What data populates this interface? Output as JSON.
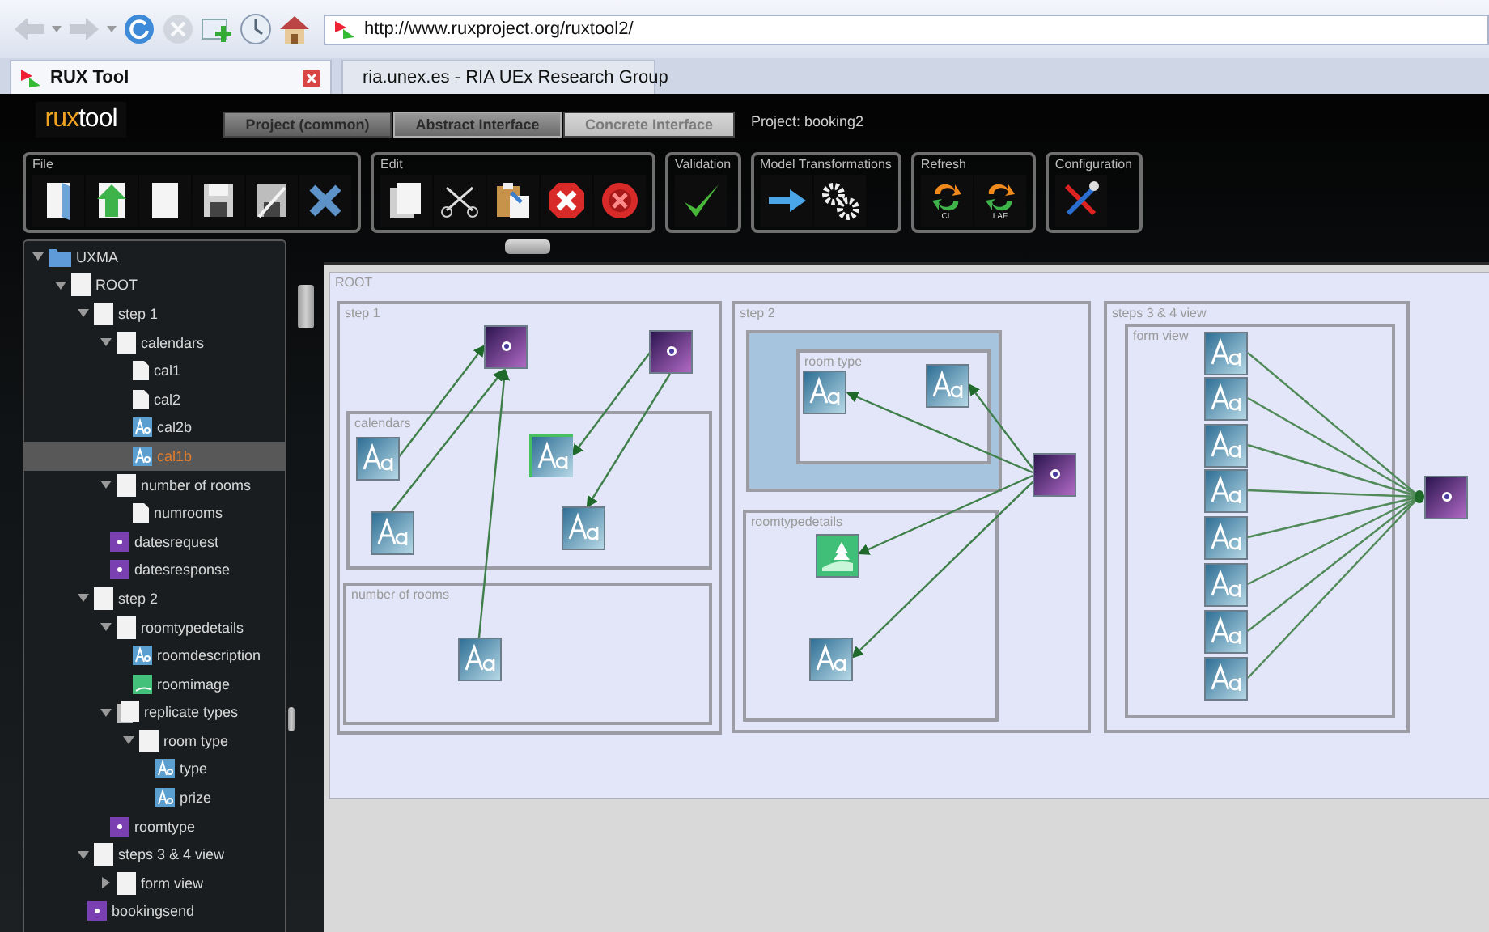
{
  "browser": {
    "nav": [
      {
        "kind": "back",
        "disabled": true
      },
      {
        "kind": "dropdown",
        "disabled": true
      },
      {
        "kind": "forward",
        "disabled": true
      },
      {
        "kind": "dropdown",
        "disabled": true
      },
      {
        "kind": "reload",
        "disabled": false
      },
      {
        "kind": "stop",
        "disabled": true
      },
      {
        "kind": "bookmark",
        "disabled": false
      },
      {
        "kind": "history",
        "disabled": false
      },
      {
        "kind": "home",
        "disabled": false
      }
    ],
    "address": "http://www.ruxproject.org/ruxtool2/",
    "tabs": [
      {
        "title": "RUX Tool",
        "selected": true
      },
      {
        "title": "ria.unex.es - RIA UEx Research Group",
        "selected": false
      }
    ]
  },
  "app": {
    "logo": {
      "accent": "rux",
      "rest": "tool"
    },
    "tabs": [
      {
        "label": "Project (common)",
        "selected": false,
        "disabled": false
      },
      {
        "label": "Abstract Interface",
        "selected": true,
        "disabled": false
      },
      {
        "label": "Concrete Interface",
        "selected": false,
        "disabled": true
      }
    ],
    "project": "Project: booking2"
  },
  "toolbar": [
    {
      "title": "File",
      "tools": [
        {
          "kind": "open"
        },
        {
          "kind": "upload"
        },
        {
          "kind": "new"
        },
        {
          "kind": "save"
        },
        {
          "kind": "save-as"
        },
        {
          "kind": "close"
        }
      ]
    },
    {
      "title": "Edit",
      "tools": [
        {
          "kind": "copy"
        },
        {
          "kind": "cut"
        },
        {
          "kind": "paste"
        },
        {
          "kind": "delete"
        },
        {
          "kind": "remove"
        }
      ]
    },
    {
      "title": "Validation",
      "tools": [
        {
          "kind": "validate"
        }
      ]
    },
    {
      "title": "Model Transformations",
      "tools": [
        {
          "kind": "transform"
        },
        {
          "kind": "gears"
        }
      ]
    },
    {
      "title": "Refresh",
      "tools": [
        {
          "kind": "refresh",
          "caption": "CL"
        },
        {
          "kind": "refresh",
          "caption": "LAF"
        }
      ]
    },
    {
      "title": "Configuration",
      "tools": [
        {
          "kind": "tools"
        }
      ]
    }
  ],
  "tree": [
    {
      "label": "UXMA",
      "kind": "folder",
      "expanded": true,
      "selected": false,
      "children": [
        {
          "label": "ROOT",
          "kind": "container",
          "expanded": true,
          "selected": false,
          "children": [
            {
              "label": "step 1",
              "kind": "container",
              "expanded": true,
              "selected": false,
              "children": [
                {
                  "label": "calendars",
                  "kind": "container",
                  "expanded": true,
                  "selected": false,
                  "children": [
                    {
                      "label": "cal1",
                      "kind": "doc",
                      "selected": false
                    },
                    {
                      "label": "cal2",
                      "kind": "doc",
                      "selected": false
                    },
                    {
                      "label": "cal2b",
                      "kind": "text",
                      "selected": false
                    },
                    {
                      "label": "cal1b",
                      "kind": "text",
                      "selected": true
                    }
                  ]
                },
                {
                  "label": "number of rooms",
                  "kind": "container",
                  "expanded": true,
                  "selected": false,
                  "children": [
                    {
                      "label": "numrooms",
                      "kind": "doc",
                      "selected": false
                    }
                  ]
                },
                {
                  "label": "datesrequest",
                  "kind": "event",
                  "selected": false
                },
                {
                  "label": "datesresponse",
                  "kind": "event",
                  "selected": false
                }
              ]
            },
            {
              "label": "step 2",
              "kind": "container",
              "expanded": true,
              "selected": false,
              "children": [
                {
                  "label": "roomtypedetails",
                  "kind": "container",
                  "expanded": true,
                  "selected": false,
                  "children": [
                    {
                      "label": "roomdescription",
                      "kind": "text",
                      "selected": false
                    },
                    {
                      "label": "roomimage",
                      "kind": "image",
                      "selected": false
                    }
                  ]
                },
                {
                  "label": "replicate types",
                  "kind": "stack",
                  "expanded": true,
                  "selected": false,
                  "children": [
                    {
                      "label": "room type",
                      "kind": "container",
                      "expanded": true,
                      "selected": false,
                      "children": [
                        {
                          "label": "type",
                          "kind": "text",
                          "selected": false
                        },
                        {
                          "label": "prize",
                          "kind": "text",
                          "selected": false
                        }
                      ]
                    }
                  ]
                },
                {
                  "label": "roomtype",
                  "kind": "event",
                  "selected": false
                }
              ]
            },
            {
              "label": "steps 3 & 4 view",
              "kind": "container",
              "expanded": true,
              "selected": false,
              "children": [
                {
                  "label": "form view",
                  "kind": "container",
                  "expanded": false,
                  "selected": false
                }
              ]
            },
            {
              "label": "bookingsend",
              "kind": "event",
              "selected": false
            }
          ]
        }
      ]
    }
  ],
  "diagram": {
    "containers": [
      {
        "kind": "panel",
        "label": "ROOT"
      },
      {
        "kind": "panel",
        "label": "step 1"
      },
      {
        "kind": "panel",
        "label": "calendars"
      },
      {
        "kind": "panel",
        "label": "number of rooms"
      },
      {
        "kind": "panel",
        "label": "step 2"
      },
      {
        "kind": "replicator"
      },
      {
        "kind": "panel",
        "label": "room type"
      },
      {
        "kind": "panel",
        "label": "roomtypedetails"
      },
      {
        "kind": "panel",
        "label": "steps 3 & 4 view"
      },
      {
        "kind": "panel",
        "label": "form view"
      }
    ],
    "nodes": [
      {
        "kind": "event",
        "selected": false
      },
      {
        "kind": "event",
        "selected": false
      },
      {
        "kind": "text",
        "selected": false
      },
      {
        "kind": "text",
        "selected": false
      },
      {
        "kind": "text",
        "selected": true
      },
      {
        "kind": "text",
        "selected": false
      },
      {
        "kind": "text",
        "selected": false
      },
      {
        "kind": "event",
        "selected": false
      },
      {
        "kind": "text",
        "selected": false
      },
      {
        "kind": "text",
        "selected": false
      },
      {
        "kind": "image",
        "selected": false
      },
      {
        "kind": "text",
        "selected": false
      },
      {
        "kind": "text",
        "selected": false
      },
      {
        "kind": "text",
        "selected": false
      },
      {
        "kind": "text",
        "selected": false
      },
      {
        "kind": "text",
        "selected": false
      },
      {
        "kind": "text",
        "selected": false
      },
      {
        "kind": "text",
        "selected": false
      },
      {
        "kind": "text",
        "selected": false
      },
      {
        "kind": "text",
        "selected": false
      },
      {
        "kind": "event",
        "selected": false
      }
    ]
  }
}
